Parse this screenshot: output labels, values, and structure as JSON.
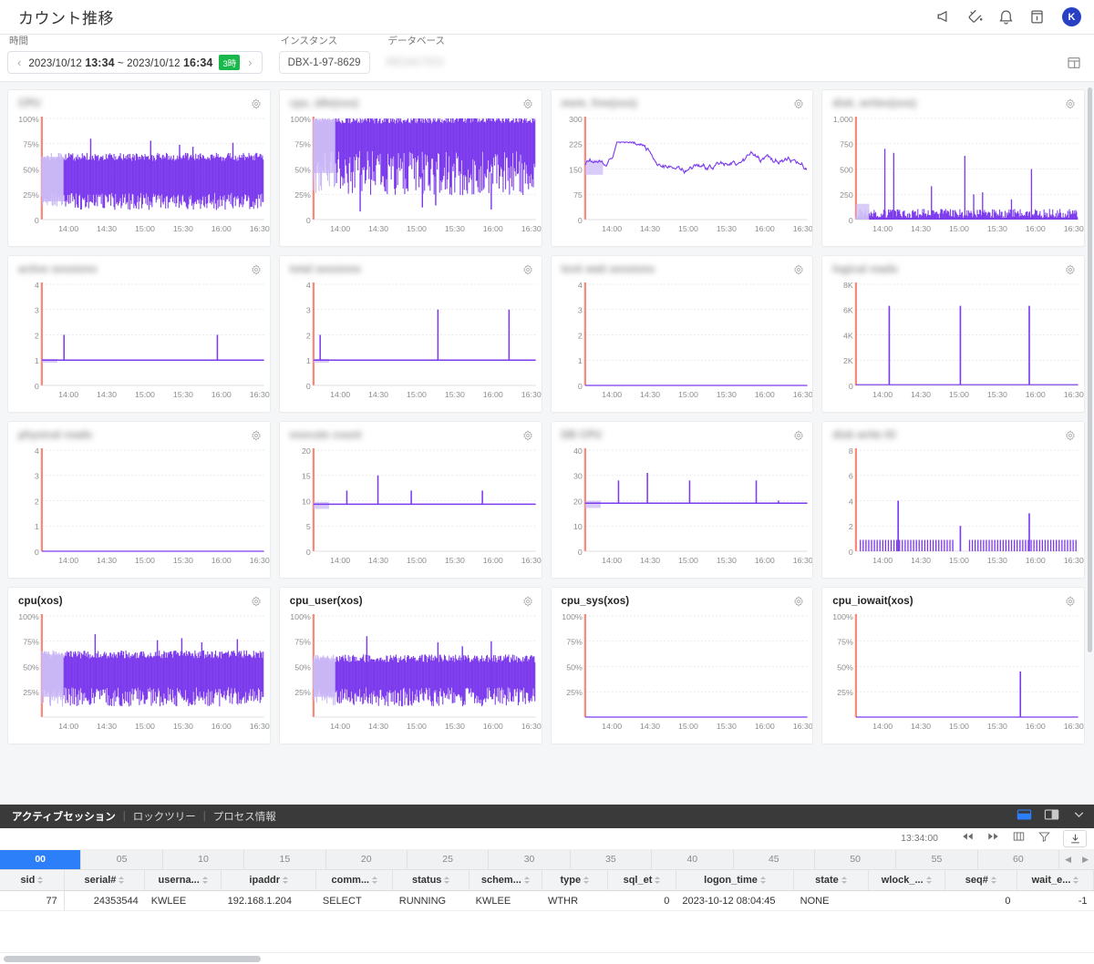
{
  "header": {
    "title": "カウント推移",
    "icons": [
      {
        "name": "megaphone-icon"
      },
      {
        "name": "paint-bucket-icon"
      },
      {
        "name": "bell-icon"
      },
      {
        "name": "info-box-icon"
      }
    ],
    "avatar_initial": "K"
  },
  "filters": {
    "time_label": "時間",
    "time_prev": "‹",
    "time_next": "›",
    "time_from_date": "2023/10/12",
    "time_from_clock": "13:34",
    "time_sep": "~",
    "time_to_date": "2023/10/12",
    "time_to_clock": "16:34",
    "range_badge": "3時",
    "instance_label": "インスタンス",
    "instance_value": "DBX-1-97-8629",
    "database_label": "データベース",
    "database_value": "REDACTED",
    "layout_toggle_icon": "layout-grid-icon"
  },
  "colors": {
    "series": "#7c3aed",
    "series_light": "#c9b6f5",
    "axis": "#f98a7a",
    "accent_blue": "#2d7ff9",
    "badge_green": "#19b84b",
    "avatar_blue": "#2740c4"
  },
  "charts": {
    "x_ticks": [
      "14:00",
      "14:30",
      "15:00",
      "15:30",
      "16:00",
      "16:30"
    ],
    "panels": [
      {
        "title": "CPU",
        "blurred": true,
        "y_ticks": [
          "100%",
          "75%",
          "50%",
          "25%",
          "0"
        ],
        "ymax": 100,
        "shape": "noise-band",
        "band_low": 18,
        "band_high": 62,
        "spikes": [
          [
            0.22,
            80
          ],
          [
            0.49,
            78
          ],
          [
            0.62,
            74
          ],
          [
            0.68,
            72
          ],
          [
            0.86,
            76
          ]
        ]
      },
      {
        "title": "cpu_idle(xos)",
        "blurred": true,
        "y_ticks": [
          "100%",
          "75%",
          "50%",
          "25%",
          "0"
        ],
        "ymax": 100,
        "shape": "noise-band",
        "band_low": 46,
        "band_high": 99,
        "spikes": [
          [
            0.21,
            8
          ],
          [
            0.49,
            12
          ],
          [
            0.55,
            14
          ],
          [
            0.8,
            10
          ]
        ]
      },
      {
        "title": "mem_free(xos)",
        "blurred": true,
        "y_ticks": [
          "300",
          "225",
          "150",
          "75",
          "0"
        ],
        "ymax": 300,
        "shape": "line-wander",
        "base": 155,
        "amp": 22,
        "spikes": [
          [
            0.17,
            242
          ]
        ]
      },
      {
        "title": "disk_writes(xos)",
        "blurred": true,
        "y_ticks": [
          "1,000",
          "750",
          "500",
          "250",
          "0"
        ],
        "ymax": 1000,
        "shape": "spiky-floor",
        "base": 60,
        "spikes": [
          [
            0.13,
            700
          ],
          [
            0.17,
            660
          ],
          [
            0.34,
            330
          ],
          [
            0.49,
            630
          ],
          [
            0.53,
            250
          ],
          [
            0.57,
            270
          ],
          [
            0.7,
            200
          ],
          [
            0.79,
            500
          ]
        ]
      },
      {
        "title": "active sessions",
        "blurred": true,
        "y_ticks": [
          "4",
          "3",
          "2",
          "1",
          "0"
        ],
        "ymax": 4,
        "shape": "flat-step",
        "base": 1,
        "spikes": [
          [
            0.1,
            2
          ],
          [
            0.79,
            2
          ]
        ]
      },
      {
        "title": "total sessions",
        "blurred": true,
        "y_ticks": [
          "4",
          "3",
          "2",
          "1",
          "0"
        ],
        "ymax": 4,
        "shape": "flat-step",
        "base": 1,
        "spikes": [
          [
            0.03,
            2
          ],
          [
            0.56,
            3
          ],
          [
            0.88,
            3
          ]
        ]
      },
      {
        "title": "lock wait sessions",
        "blurred": true,
        "y_ticks": [
          "4",
          "3",
          "2",
          "1",
          "0"
        ],
        "ymax": 4,
        "shape": "zero-line",
        "base": 0,
        "spikes": []
      },
      {
        "title": "logical reads",
        "blurred": true,
        "y_ticks": [
          "8K",
          "6K",
          "4K",
          "2K",
          "0"
        ],
        "ymax": 8000,
        "shape": "zero-line",
        "base": 60,
        "spikes": [
          [
            0.15,
            6300
          ],
          [
            0.47,
            6300
          ],
          [
            0.78,
            6300
          ]
        ]
      },
      {
        "title": "physical reads",
        "blurred": true,
        "y_ticks": [
          "4",
          "3",
          "2",
          "1",
          "0"
        ],
        "ymax": 4,
        "shape": "zero-line",
        "base": 0,
        "spikes": []
      },
      {
        "title": "execute count",
        "blurred": true,
        "y_ticks": [
          "20",
          "15",
          "10",
          "5",
          "0"
        ],
        "ymax": 20,
        "shape": "flat-step",
        "base": 9.3,
        "spikes": [
          [
            0.15,
            12
          ],
          [
            0.29,
            15
          ],
          [
            0.44,
            12
          ],
          [
            0.76,
            12
          ]
        ]
      },
      {
        "title": "DB CPU",
        "blurred": true,
        "y_ticks": [
          "40",
          "30",
          "20",
          "10",
          "0"
        ],
        "ymax": 40,
        "shape": "flat-step",
        "base": 19,
        "spikes": [
          [
            0.15,
            28
          ],
          [
            0.28,
            31
          ],
          [
            0.47,
            28
          ],
          [
            0.77,
            28
          ],
          [
            0.87,
            20
          ]
        ]
      },
      {
        "title": "disk write IO",
        "blurred": true,
        "y_ticks": [
          "8",
          "6",
          "4",
          "2",
          "0"
        ],
        "ymax": 8,
        "shape": "comb",
        "base": 0.9,
        "spikes": [
          [
            0.19,
            4
          ],
          [
            0.47,
            2
          ],
          [
            0.78,
            3
          ]
        ]
      },
      {
        "title": "cpu(xos)",
        "blurred": false,
        "y_ticks": [
          "100%",
          "75%",
          "50%",
          "25%"
        ],
        "ymax": 100,
        "shape": "noise-band",
        "band_low": 20,
        "band_high": 62,
        "spikes": [
          [
            0.24,
            82
          ],
          [
            0.52,
            76
          ],
          [
            0.63,
            78
          ],
          [
            0.72,
            74
          ],
          [
            0.88,
            77
          ]
        ]
      },
      {
        "title": "cpu_user(xos)",
        "blurred": false,
        "y_ticks": [
          "100%",
          "75%",
          "50%",
          "25%"
        ],
        "ymax": 100,
        "shape": "noise-band",
        "band_low": 20,
        "band_high": 58,
        "spikes": [
          [
            0.24,
            80
          ],
          [
            0.56,
            74
          ],
          [
            0.67,
            70
          ],
          [
            0.8,
            75
          ]
        ]
      },
      {
        "title": "cpu_sys(xos)",
        "blurred": false,
        "y_ticks": [
          "100%",
          "75%",
          "50%",
          "25%"
        ],
        "ymax": 100,
        "shape": "zero-line",
        "base": 0,
        "spikes": []
      },
      {
        "title": "cpu_iowait(xos)",
        "blurred": false,
        "y_ticks": [
          "100%",
          "75%",
          "50%",
          "25%"
        ],
        "ymax": 100,
        "shape": "zero-line",
        "base": 0,
        "spikes": [
          [
            0.74,
            45
          ]
        ]
      }
    ]
  },
  "chart_data": {
    "type": "line",
    "title": "カウント推移",
    "xlabel": "",
    "ylabel": "",
    "x_range": [
      "2023/10/12 13:34",
      "2023/10/12 16:34"
    ],
    "x_tick_labels": [
      "14:00",
      "14:30",
      "15:00",
      "15:30",
      "16:00",
      "16:30"
    ],
    "grid": true,
    "legend": "none",
    "series": [
      {
        "name": "CPU",
        "ylim": [
          0,
          100
        ],
        "unit": "%",
        "y_tick_labels": [
          "0",
          "25%",
          "50%",
          "75%",
          "100%"
        ],
        "typical_range": [
          18,
          62
        ],
        "peaks": [
          80,
          78,
          74,
          72,
          76
        ]
      },
      {
        "name": "cpu_idle(xos)",
        "ylim": [
          0,
          100
        ],
        "unit": "%",
        "y_tick_labels": [
          "0",
          "25%",
          "50%",
          "75%",
          "100%"
        ],
        "typical_range": [
          46,
          99
        ],
        "troughs": [
          8,
          12,
          14,
          10
        ]
      },
      {
        "name": "mem_free(xos)",
        "ylim": [
          0,
          300
        ],
        "unit": "",
        "y_tick_labels": [
          "0",
          "75",
          "150",
          "225",
          "300"
        ],
        "typical_range": [
          135,
          200
        ],
        "peaks": [
          242
        ]
      },
      {
        "name": "disk_writes(xos)",
        "ylim": [
          0,
          1000
        ],
        "unit": "",
        "y_tick_labels": [
          "0",
          "250",
          "500",
          "750",
          "1,000"
        ],
        "typical_range": [
          0,
          120
        ],
        "peaks": [
          700,
          660,
          630,
          500,
          330,
          270,
          250,
          200
        ]
      },
      {
        "name": "active sessions",
        "ylim": [
          0,
          4
        ],
        "unit": "",
        "y_tick_labels": [
          "0",
          "1",
          "2",
          "3",
          "4"
        ],
        "baseline": 1,
        "peaks": [
          2,
          2
        ]
      },
      {
        "name": "total sessions",
        "ylim": [
          0,
          4
        ],
        "unit": "",
        "y_tick_labels": [
          "0",
          "1",
          "2",
          "3",
          "4"
        ],
        "baseline": 1,
        "peaks": [
          2,
          3,
          3
        ]
      },
      {
        "name": "lock wait sessions",
        "ylim": [
          0,
          4
        ],
        "unit": "",
        "y_tick_labels": [
          "0",
          "1",
          "2",
          "3",
          "4"
        ],
        "baseline": 0,
        "peaks": []
      },
      {
        "name": "logical reads",
        "ylim": [
          0,
          8000
        ],
        "unit": "",
        "y_tick_labels": [
          "0",
          "2K",
          "4K",
          "6K",
          "8K"
        ],
        "baseline": 60,
        "peaks": [
          6300,
          6300,
          6300
        ]
      },
      {
        "name": "physical reads",
        "ylim": [
          0,
          4
        ],
        "unit": "",
        "y_tick_labels": [
          "0",
          "1",
          "2",
          "3",
          "4"
        ],
        "baseline": 0,
        "peaks": []
      },
      {
        "name": "execute count",
        "ylim": [
          0,
          20
        ],
        "unit": "",
        "y_tick_labels": [
          "0",
          "5",
          "10",
          "15",
          "20"
        ],
        "baseline": 9.3,
        "peaks": [
          12,
          15,
          12,
          12
        ]
      },
      {
        "name": "DB CPU",
        "ylim": [
          0,
          40
        ],
        "unit": "",
        "y_tick_labels": [
          "0",
          "10",
          "20",
          "30",
          "40"
        ],
        "baseline": 19,
        "peaks": [
          28,
          31,
          28,
          28
        ]
      },
      {
        "name": "disk write IO",
        "ylim": [
          0,
          8
        ],
        "unit": "",
        "y_tick_labels": [
          "0",
          "2",
          "4",
          "6",
          "8"
        ],
        "baseline": 0.9,
        "peaks": [
          4,
          2,
          3
        ]
      },
      {
        "name": "cpu(xos)",
        "ylim": [
          0,
          100
        ],
        "unit": "%",
        "y_tick_labels": [
          "25%",
          "50%",
          "75%",
          "100%"
        ],
        "typical_range": [
          20,
          62
        ],
        "peaks": [
          82,
          78,
          77,
          76,
          74
        ]
      },
      {
        "name": "cpu_user(xos)",
        "ylim": [
          0,
          100
        ],
        "unit": "%",
        "y_tick_labels": [
          "25%",
          "50%",
          "75%",
          "100%"
        ],
        "typical_range": [
          20,
          58
        ],
        "peaks": [
          80,
          75,
          74,
          70
        ]
      },
      {
        "name": "cpu_sys(xos)",
        "ylim": [
          0,
          100
        ],
        "unit": "%",
        "y_tick_labels": [
          "25%",
          "50%",
          "75%",
          "100%"
        ],
        "baseline": 0,
        "peaks": []
      },
      {
        "name": "cpu_iowait(xos)",
        "ylim": [
          0,
          100
        ],
        "unit": "%",
        "y_tick_labels": [
          "25%",
          "50%",
          "75%",
          "100%"
        ],
        "baseline": 0,
        "peaks": [
          45
        ]
      }
    ]
  },
  "bottom": {
    "tabs": [
      {
        "label": "アクティブセッション",
        "active": true
      },
      {
        "label": "ロックツリー",
        "active": false
      },
      {
        "label": "プロセス情報",
        "active": false
      }
    ],
    "separator": "|",
    "view_icons": [
      {
        "name": "panel-bottom-icon",
        "active": true
      },
      {
        "name": "panel-right-icon",
        "active": false
      },
      {
        "name": "chevron-down-icon",
        "active": false
      }
    ],
    "timestamp": "13:34:00",
    "toolbar_icons": [
      {
        "name": "rewind-icon"
      },
      {
        "name": "fast-forward-icon"
      },
      {
        "name": "columns-icon"
      },
      {
        "name": "filter-icon"
      },
      {
        "name": "download-icon"
      }
    ],
    "ruler": [
      "00",
      "05",
      "10",
      "15",
      "20",
      "25",
      "30",
      "35",
      "40",
      "45",
      "50",
      "55",
      "60"
    ],
    "ruler_selected": "00",
    "ruler_nav_prev": "◀",
    "ruler_nav_next": "▶"
  },
  "table": {
    "columns": [
      {
        "key": "sid",
        "label": "sid",
        "align": "num",
        "width": "6.2%"
      },
      {
        "key": "serial",
        "label": "serial#",
        "align": "num",
        "width": "7.8%"
      },
      {
        "key": "username",
        "label": "userna...",
        "align": "txt",
        "width": "7.4%"
      },
      {
        "key": "ipaddr",
        "label": "ipaddr",
        "align": "txt",
        "width": "9.2%"
      },
      {
        "key": "command",
        "label": "comm...",
        "align": "txt",
        "width": "7.4%"
      },
      {
        "key": "status",
        "label": "status",
        "align": "txt",
        "width": "7.4%"
      },
      {
        "key": "schema",
        "label": "schem...",
        "align": "txt",
        "width": "7.0%"
      },
      {
        "key": "type",
        "label": "type",
        "align": "txt",
        "width": "6.4%"
      },
      {
        "key": "sql_et",
        "label": "sql_et",
        "align": "num",
        "width": "6.6%"
      },
      {
        "key": "logon_time",
        "label": "logon_time",
        "align": "txt",
        "width": "11.4%"
      },
      {
        "key": "state",
        "label": "state",
        "align": "txt",
        "width": "7.2%"
      },
      {
        "key": "wlock",
        "label": "wlock_...",
        "align": "txt",
        "width": "7.4%"
      },
      {
        "key": "seq",
        "label": "seq#",
        "align": "num",
        "width": "7.0%"
      },
      {
        "key": "wait_e",
        "label": "wait_e...",
        "align": "num",
        "width": "7.4%"
      }
    ],
    "rows": [
      {
        "sid": "77",
        "serial": "24353544",
        "username": "KWLEE",
        "ipaddr": "192.168.1.204",
        "command": "SELECT",
        "status": "RUNNING",
        "schema": "KWLEE",
        "type": "WTHR",
        "sql_et": "0",
        "logon_time": "2023-10-12 08:04:45",
        "state": "NONE",
        "wlock": "",
        "seq": "0",
        "wait_e": "-1"
      }
    ]
  }
}
